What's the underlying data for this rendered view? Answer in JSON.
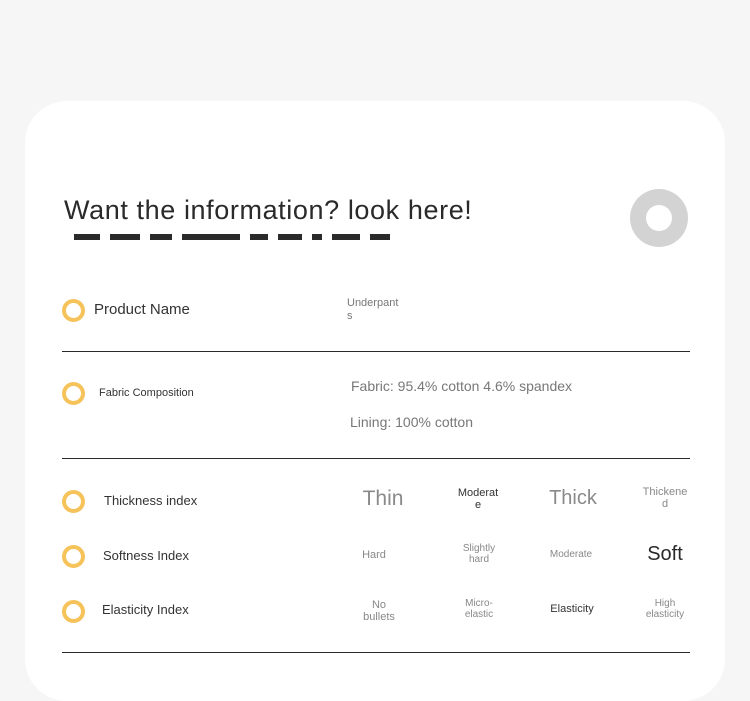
{
  "heading": "Want the information? look here!",
  "rows": {
    "product_name": {
      "label": "Product Name",
      "value": "Underpants"
    },
    "fabric_composition": {
      "label": "Fabric Composition",
      "fabric": "Fabric: 95.4% cotton 4.6% spandex",
      "lining": "Lining: 100% cotton"
    },
    "thickness": {
      "label": "Thickness index",
      "options": [
        "Thin",
        "Moderate",
        "Thick",
        "Thickened"
      ],
      "selected": "Thin"
    },
    "softness": {
      "label": "Softness Index",
      "options": [
        "Hard",
        "Slightly hard",
        "Moderate",
        "Soft"
      ],
      "selected": "Soft"
    },
    "elasticity": {
      "label": "Elasticity Index",
      "options": [
        "No bullets",
        "Micro-elastic",
        "Elasticity",
        "High elasticity"
      ],
      "selected": "Elasticity"
    }
  },
  "colors": {
    "accent_ring": "#f5c35a",
    "page_background": "#f6f6f7",
    "card_background": "#ffffff"
  },
  "icons": [
    "ring-bullet-icon",
    "ring-decoration-icon"
  ]
}
